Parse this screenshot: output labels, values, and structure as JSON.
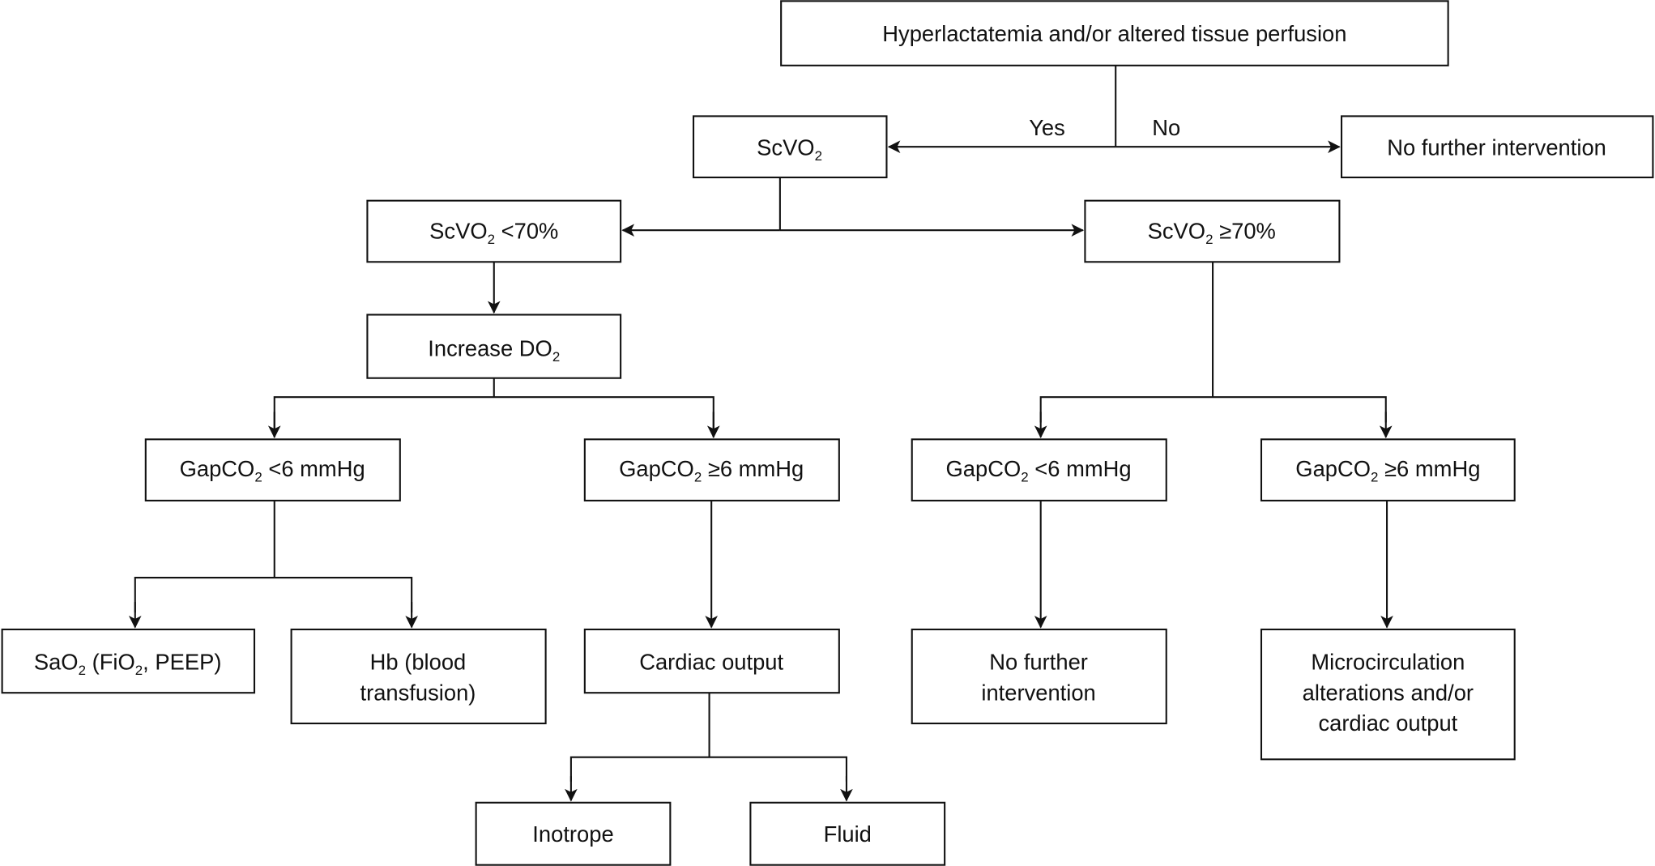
{
  "colors": {
    "stroke": "#111111",
    "background": "#ffffff"
  },
  "nodes": {
    "root": {
      "text": "Hyperlactatemia and/or altered tissue perfusion"
    },
    "scvo2": {
      "parts": [
        "ScVO",
        "2"
      ]
    },
    "no_intervention_top": {
      "text": "No further intervention"
    },
    "scvo2_low": {
      "parts": [
        "ScVO",
        "2",
        " <70%"
      ]
    },
    "scvo2_high": {
      "parts": [
        "ScVO",
        "2",
        " ≥70%"
      ]
    },
    "increase_do2": {
      "parts": [
        "Increase DO",
        "2"
      ]
    },
    "gap_low_left": {
      "parts": [
        "GapCO",
        "2",
        " <6 mmHg"
      ]
    },
    "gap_high_left": {
      "parts": [
        "GapCO",
        "2",
        " ≥6 mmHg"
      ]
    },
    "gap_low_right": {
      "parts": [
        "GapCO",
        "2",
        " <6 mmHg"
      ]
    },
    "gap_high_right": {
      "parts": [
        "GapCO",
        "2",
        " ≥6 mmHg"
      ]
    },
    "sao2": {
      "parts": [
        "SaO",
        "2",
        " (FiO",
        "2",
        ", PEEP)"
      ]
    },
    "hb": {
      "lines": [
        "Hb (blood",
        "transfusion)"
      ]
    },
    "cardiac_output": {
      "text": "Cardiac output"
    },
    "no_intervention_bottom": {
      "lines": [
        "No further",
        "intervention"
      ]
    },
    "microcirculation": {
      "lines": [
        "Microcirculation",
        "alterations and/or",
        "cardiac output"
      ]
    },
    "inotrope": {
      "text": "Inotrope"
    },
    "fluid": {
      "text": "Fluid"
    }
  },
  "edge_labels": {
    "yes": "Yes",
    "no": "No"
  }
}
